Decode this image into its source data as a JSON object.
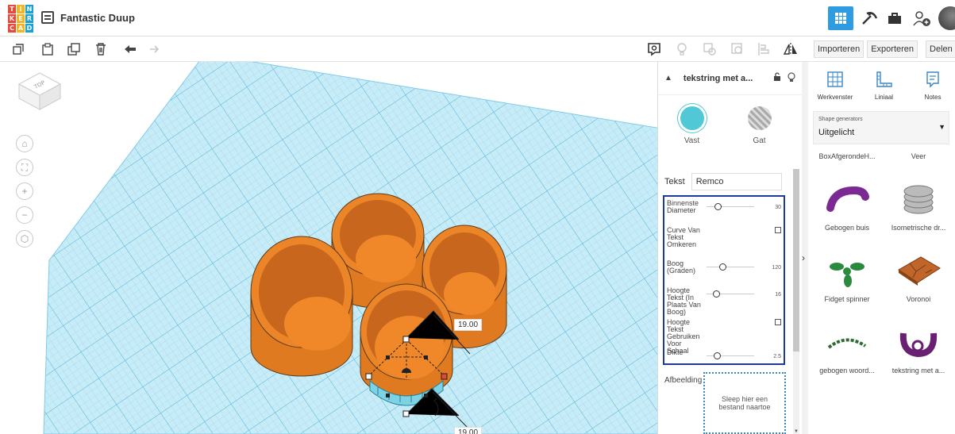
{
  "app": {
    "title": "Fantastic Duup",
    "logo_letters": [
      "T",
      "I",
      "N",
      "K",
      "E",
      "R",
      "C",
      "A",
      "D"
    ],
    "logo_colors": [
      "#e8493d",
      "#f4b41f",
      "#16a2d4",
      "#e8493d",
      "#f4b41f",
      "#16a2d4",
      "#e8493d",
      "#f4b41f",
      "#16a2d4"
    ]
  },
  "topbar_icons": [
    "grid-view-icon",
    "pickaxe-icon",
    "briefcase-icon",
    "add-user-icon"
  ],
  "toolbar": {
    "left_icons": [
      "copy-icon",
      "paste-icon",
      "duplicate-icon",
      "delete-icon",
      "undo-icon",
      "redo-icon"
    ],
    "right_icons": [
      "note-icon",
      "light-icon",
      "group-icon",
      "ungroup-icon",
      "align-icon",
      "mirror-icon"
    ],
    "import_label": "Importeren",
    "export_label": "Exporteren",
    "share_label": "Delen"
  },
  "viewport": {
    "navcube_label": "TOP",
    "nav_buttons": [
      "home-icon",
      "fit-icon",
      "zoom-in-icon",
      "zoom-out-icon",
      "view-3d-icon"
    ],
    "dim_top": "19.00",
    "dim_bottom": "19.00"
  },
  "inspector": {
    "shape_name": "tekstring met a...",
    "solid_label": "Vast",
    "hole_label": "Gat",
    "text_label": "Tekst",
    "text_value": "Remco",
    "params": [
      {
        "label": "Binnenste Diameter",
        "type": "slider",
        "value": "30",
        "pos": 0.05
      },
      {
        "label": "Curve Van Tekst Omkeren",
        "type": "checkbox"
      },
      {
        "label": "Boog (Graden)",
        "type": "slider",
        "value": "120",
        "pos": 0.2
      },
      {
        "label": "Hoogte Tekst (In Plaats Van Boog)",
        "type": "slider",
        "value": "16",
        "pos": 0.0
      },
      {
        "label": "Hoogte Tekst Gebruiken Voor Schaal",
        "type": "checkbox"
      },
      {
        "label": "Dikte",
        "type": "slider",
        "value": "2.5",
        "pos": 0.02
      }
    ],
    "image_label": "Afbeelding",
    "drop_text": "Sleep hier een bestand naartoe"
  },
  "library": {
    "tools": [
      {
        "label": "Werkvenster",
        "icon": "workplane-icon"
      },
      {
        "label": "Liniaal",
        "icon": "ruler-icon"
      },
      {
        "label": "Notes",
        "icon": "notes-icon"
      }
    ],
    "generator_caption": "Shape generators",
    "generator_value": "Uitgelicht",
    "shapes": [
      {
        "label": "BoxAfgerondeH...",
        "icon": "none"
      },
      {
        "label": "Veer",
        "icon": "none"
      },
      {
        "label": "Gebogen buis",
        "icon": "bent-tube-icon"
      },
      {
        "label": "Isometrische dr...",
        "icon": "thread-icon"
      },
      {
        "label": "Fidget spinner",
        "icon": "fidget-spinner-icon"
      },
      {
        "label": "Voronoi",
        "icon": "voronoi-icon"
      },
      {
        "label": "gebogen woord...",
        "icon": "curved-word-icon"
      },
      {
        "label": "tekstring met a...",
        "icon": "text-ring-icon"
      }
    ]
  }
}
